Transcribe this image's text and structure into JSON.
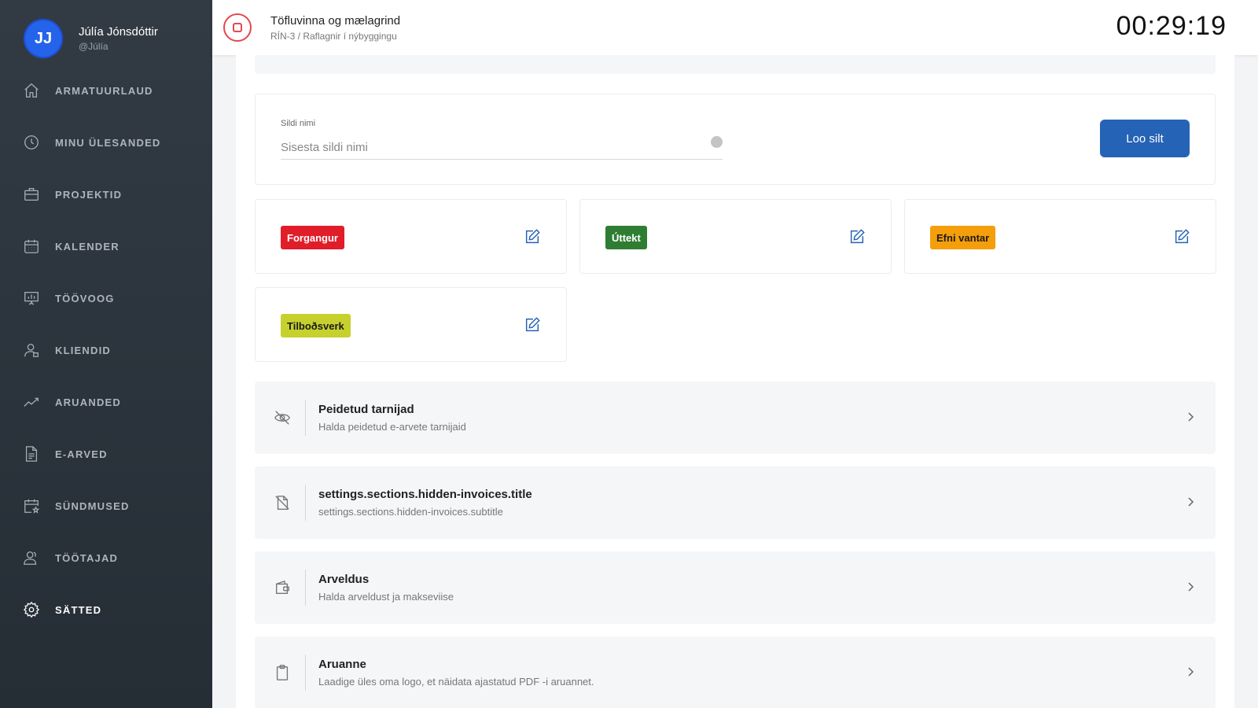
{
  "user": {
    "initials": "JJ",
    "name": "Júlía Jónsdóttir",
    "handle": "@Júlía",
    "avatar_color": "#2563eb"
  },
  "nav": [
    {
      "label": "ARMATUURLAUD",
      "icon": "home-icon"
    },
    {
      "label": "MINU ÜLESANDED",
      "icon": "clock-icon"
    },
    {
      "label": "PROJEKTID",
      "icon": "briefcase-icon"
    },
    {
      "label": "KALENDER",
      "icon": "calendar-icon"
    },
    {
      "label": "TÖÖVOOG",
      "icon": "presentation-board-icon"
    },
    {
      "label": "KLIENDID",
      "icon": "user-icon"
    },
    {
      "label": "ARUANDED",
      "icon": "trend-chart-icon"
    },
    {
      "label": "E-ARVED",
      "icon": "document-icon"
    },
    {
      "label": "SÜNDMUSED",
      "icon": "calendar-star-icon"
    },
    {
      "label": "TÖÖTAJAD",
      "icon": "users-icon"
    },
    {
      "label": "SÄTTED",
      "icon": "gear-icon",
      "active": true
    }
  ],
  "header": {
    "title": "Töfluvinna og mælagrind",
    "subtitle": "RÍN-3 / Raflagnir í nýbyggingu",
    "timer": "00:29:19",
    "stop_color": "#e5484d"
  },
  "form": {
    "label": "Sildi nimi",
    "placeholder": "Sisesta sildi nimi",
    "value": "",
    "button": "Loo silt",
    "button_color": "#2563b6"
  },
  "tags": [
    {
      "label": "Forgangur",
      "bg": "#e11d2a",
      "fg": "#ffffff"
    },
    {
      "label": "Úttekt",
      "bg": "#2f7d32",
      "fg": "#ffffff"
    },
    {
      "label": "Efni vantar",
      "bg": "#f59e0b",
      "fg": "#1a1a1a"
    },
    {
      "label": "Tilboðsverk",
      "bg": "#c6d12e",
      "fg": "#1a1a1a"
    }
  ],
  "sections": [
    {
      "title": "Peidetud tarnijad",
      "subtitle": "Halda peidetud e-arvete tarnijaid",
      "icon": "eye-off-icon"
    },
    {
      "title": "settings.sections.hidden-invoices.title",
      "subtitle": "settings.sections.hidden-invoices.subtitle",
      "icon": "file-off-icon"
    },
    {
      "title": "Arveldus",
      "subtitle": "Halda arveldust ja makseviise",
      "icon": "wallet-icon"
    },
    {
      "title": "Aruanne",
      "subtitle": "Laadige üles oma logo, et näidata ajastatud PDF -i aruannet.",
      "icon": "clipboard-icon"
    }
  ]
}
